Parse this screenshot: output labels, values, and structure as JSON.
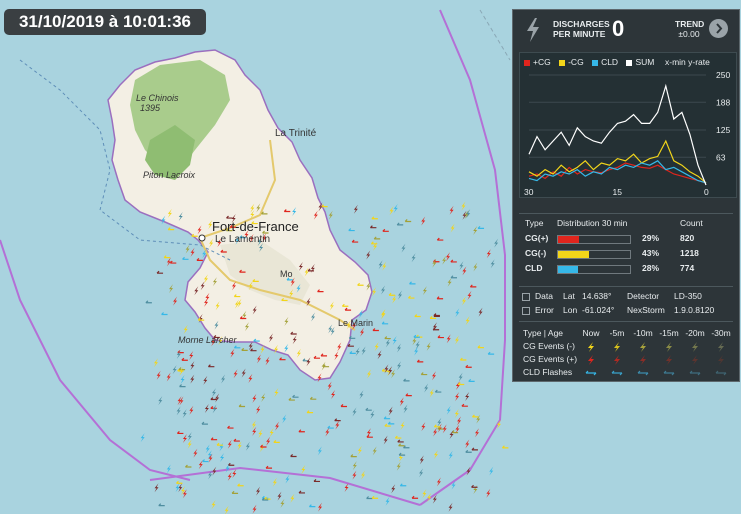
{
  "timestamp": "31/10/2019 à 10:01:36",
  "places": {
    "chinois": "Le Chinois",
    "chinois_alt": "1395",
    "piton": "Piton Lacroix",
    "trinite": "La Trinité",
    "fdf": "Fort-de-France",
    "lamentin": "Le Lamentin",
    "marin": "Le Marin",
    "morne": "Morne Larcher",
    "mo": "Mo"
  },
  "panel": {
    "discharges_label_1": "DISCHARGES",
    "discharges_label_2": "PER MINUTE",
    "discharges_value": "0",
    "trend_label": "TREND",
    "trend_value": "±0.00",
    "chart_options": "x-min y-rate",
    "distribution": {
      "headers": [
        "Type",
        "Distribution 30 min",
        "Count"
      ],
      "rows": [
        {
          "type": "CG(+)",
          "percent": "29%",
          "count": "820",
          "fraction": 0.29,
          "color": "#e0251d"
        },
        {
          "type": "CG(-)",
          "percent": "43%",
          "count": "1218",
          "fraction": 0.43,
          "color": "#f2d51a"
        },
        {
          "type": "CLD",
          "percent": "28%",
          "count": "774",
          "fraction": 0.28,
          "color": "#36b8e8"
        }
      ]
    },
    "info": {
      "data_label": "Data",
      "lat_label": "Lat",
      "lat_value": "14.638°",
      "detector_label": "Detector",
      "detector_value": "LD-350",
      "error_label": "Error",
      "lon_label": "Lon",
      "lon_value": "-61.024°",
      "software_label": "NexStorm",
      "software_value": "1.9.0.8120"
    },
    "age_table": {
      "header_type": "Type",
      "header_age": "Age",
      "columns": [
        "Now",
        "-5m",
        "-10m",
        "-15m",
        "-20m",
        "-30m"
      ],
      "rows": [
        "CG Events (-)",
        "CG Events (+)",
        "CLD Flashes"
      ]
    }
  },
  "chart_data": {
    "type": "line",
    "x_label_ticks": [
      "30",
      "15",
      "0"
    ],
    "y_ticks": [
      "250",
      "188",
      "125",
      "63"
    ],
    "xlim": [
      30,
      0
    ],
    "ylim": [
      0,
      250
    ],
    "series": [
      {
        "name": "+CG",
        "color": "#e0251d",
        "values": [
          20,
          25,
          15,
          30,
          20,
          40,
          25,
          35,
          30,
          28,
          35,
          40,
          50,
          45,
          40,
          38,
          45,
          35,
          25,
          20,
          15,
          10,
          5
        ]
      },
      {
        "name": "-CG",
        "color": "#f2d51a",
        "values": [
          30,
          20,
          35,
          25,
          45,
          30,
          40,
          55,
          35,
          50,
          45,
          60,
          55,
          70,
          50,
          60,
          65,
          100,
          55,
          45,
          30,
          20,
          5
        ]
      },
      {
        "name": "CLD",
        "color": "#36b8e8",
        "values": [
          15,
          10,
          25,
          20,
          30,
          25,
          35,
          20,
          30,
          25,
          40,
          35,
          45,
          40,
          50,
          45,
          55,
          35,
          40,
          30,
          20,
          10,
          5
        ]
      },
      {
        "name": "SUM",
        "color": "#ffffff",
        "values": [
          70,
          110,
          80,
          100,
          120,
          90,
          130,
          110,
          100,
          95,
          120,
          140,
          145,
          160,
          140,
          140,
          165,
          225,
          150,
          165,
          115,
          45,
          0
        ]
      }
    ]
  }
}
